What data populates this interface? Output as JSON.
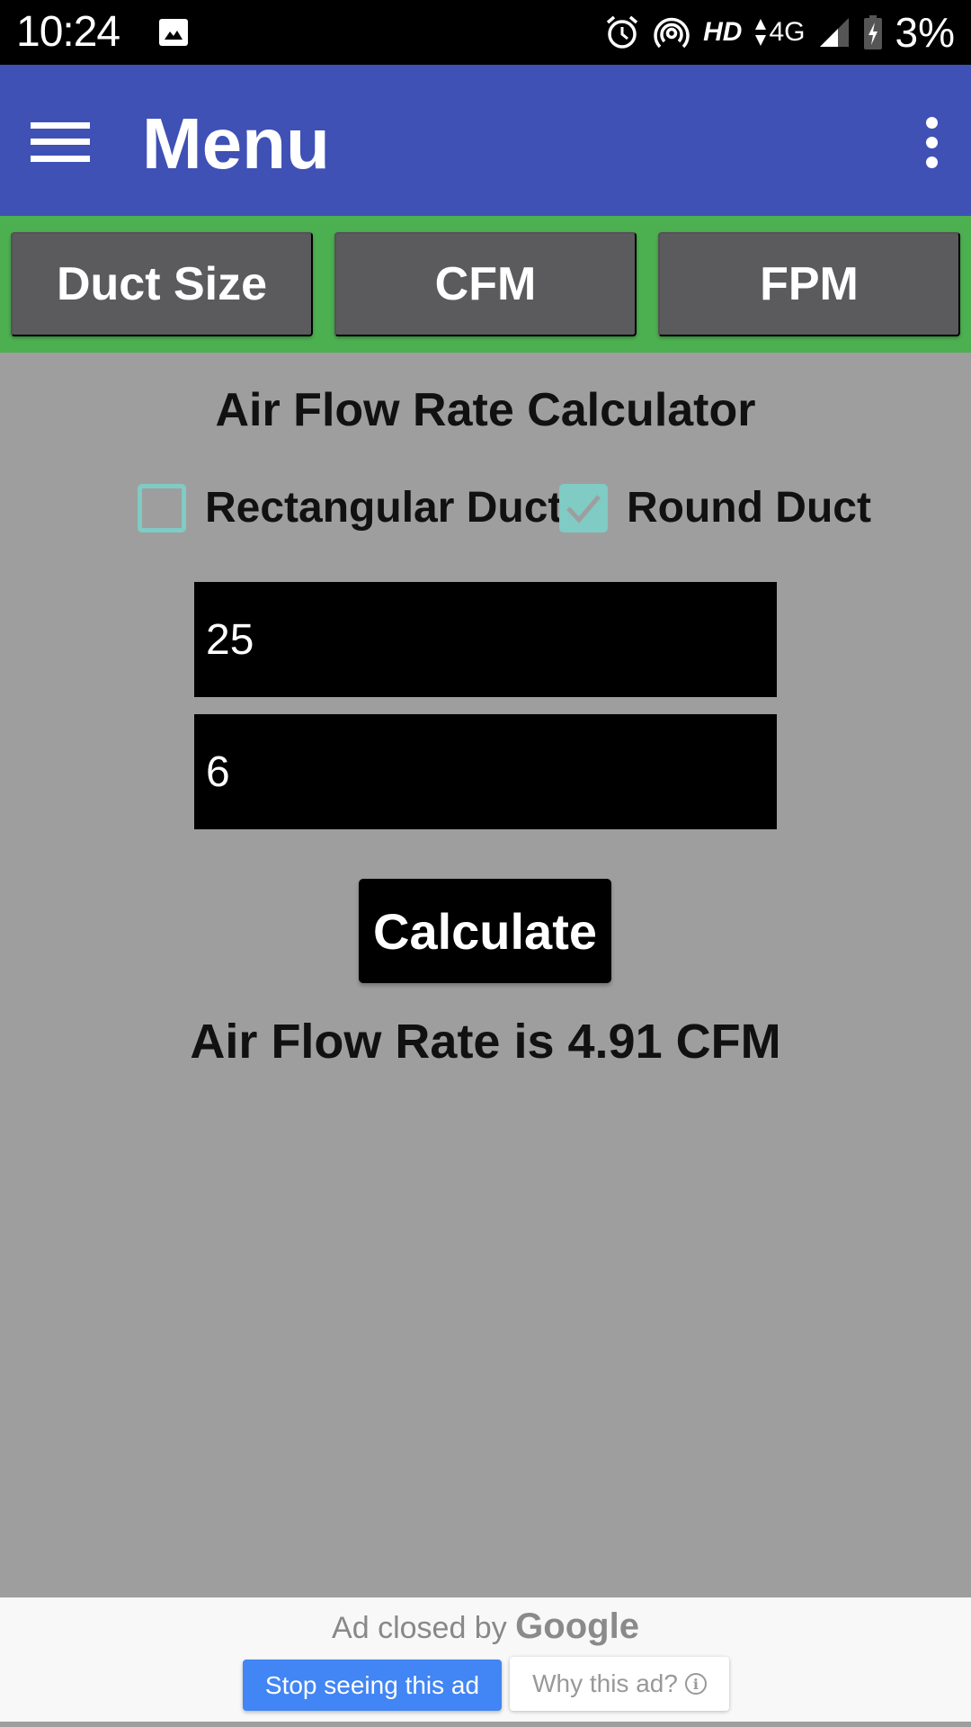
{
  "status_bar": {
    "time": "10:24",
    "hd_label": "HD",
    "network_label": "4G",
    "battery_percent": "3%",
    "icons": [
      "gallery-icon",
      "alarm-icon",
      "hotspot-icon",
      "hd-voice-icon",
      "data-arrows-icon",
      "signal-icon",
      "battery-charging-icon"
    ]
  },
  "app_bar": {
    "title": "Menu",
    "nav_icon": "hamburger-menu-icon",
    "overflow_icon": "more-vert-icon",
    "color": "#3f51b5"
  },
  "tabs": {
    "strip_color": "#4caf50",
    "items": [
      {
        "label": "Duct Size"
      },
      {
        "label": "CFM"
      },
      {
        "label": "FPM"
      }
    ]
  },
  "calculator": {
    "title": "Air Flow Rate Calculator",
    "options": [
      {
        "label": "Rectangular Duct",
        "checked": false
      },
      {
        "label": "Round Duct",
        "checked": true
      }
    ],
    "checkbox_color": "#80cbc4",
    "inputs": [
      {
        "value": "25"
      },
      {
        "value": "6"
      }
    ],
    "calculate_label": "Calculate",
    "result": "Air Flow Rate is 4.91 CFM"
  },
  "ad": {
    "closed_text": "Ad closed by",
    "brand": "Google",
    "stop_label": "Stop seeing this ad",
    "why_label": "Why this ad?",
    "stop_color": "#4285f4"
  }
}
